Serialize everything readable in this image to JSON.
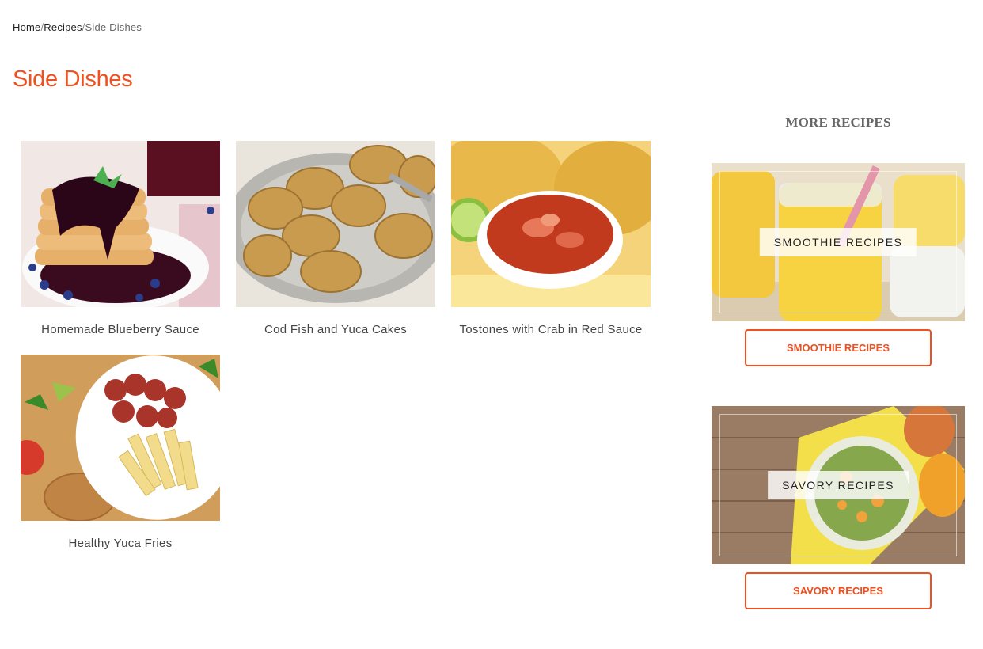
{
  "breadcrumb": {
    "items": [
      "Home",
      "Recipes"
    ],
    "separator": "/",
    "current": "Side Dishes"
  },
  "page_title": "Side Dishes",
  "recipes": [
    {
      "title": "Homemade Blueberry Sauce",
      "image": "pancakes-with-blueberry-sauce"
    },
    {
      "title": "Cod Fish and Yuca Cakes",
      "image": "fried-fish-cakes-on-platter"
    },
    {
      "title": "Tostones with Crab in Red Sauce",
      "image": "crab-in-red-sauce-with-tostones"
    },
    {
      "title": "Healthy Yuca Fries",
      "image": "yuca-fries-with-sausage"
    }
  ],
  "sidebar": {
    "heading": "MORE RECIPES",
    "promos": [
      {
        "label": "SMOOTHIE RECIPES",
        "button": "SMOOTHIE RECIPES",
        "image": "mango-smoothie-jars"
      },
      {
        "label": "SAVORY RECIPES",
        "button": "SAVORY RECIPES",
        "image": "mango-salad-bowl"
      }
    ]
  },
  "colors": {
    "accent": "#ee5022"
  }
}
